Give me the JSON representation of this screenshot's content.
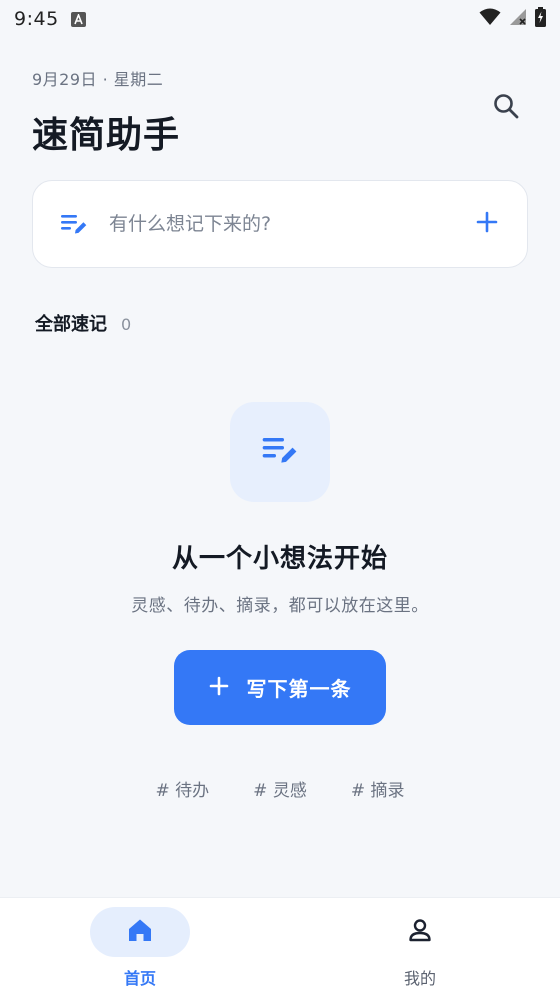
{
  "status_bar": {
    "time": "9:45",
    "icons": [
      "notification-a-icon",
      "wifi-icon",
      "signal-no-service-icon",
      "battery-charging-icon"
    ]
  },
  "header": {
    "date": "9月29日 · 星期二",
    "title": "速简助手",
    "search_icon": "search-icon"
  },
  "quick_add": {
    "icon": "notes-edit-icon",
    "add_icon": "plus-icon"
  },
  "section": {
    "title": "全部速记",
    "count": "0"
  },
  "empty_state": {
    "icon": "notes-edit-icon",
    "title": "从一个小想法开始",
    "subtitle": "灵感、待办、摘录，都可以放在这里。"
  },
  "primary_action": {
    "icon": "plus-icon",
    "label": "写下第一条"
  },
  "tags": [
    "# 待办",
    "# 灵感",
    "# 摘录"
  ],
  "bottom_nav": {
    "items": [
      {
        "label": "首页",
        "icon": "home-icon",
        "active": true
      },
      {
        "label": "我的",
        "icon": "person-icon",
        "active": false
      }
    ]
  },
  "colors": {
    "accent": "#3478f6",
    "background": "#f5f7fa",
    "accent_light": "#e7effd"
  },
  "search": {
    "quickAddPlaceholder": "有什么想记下来的?"
  }
}
